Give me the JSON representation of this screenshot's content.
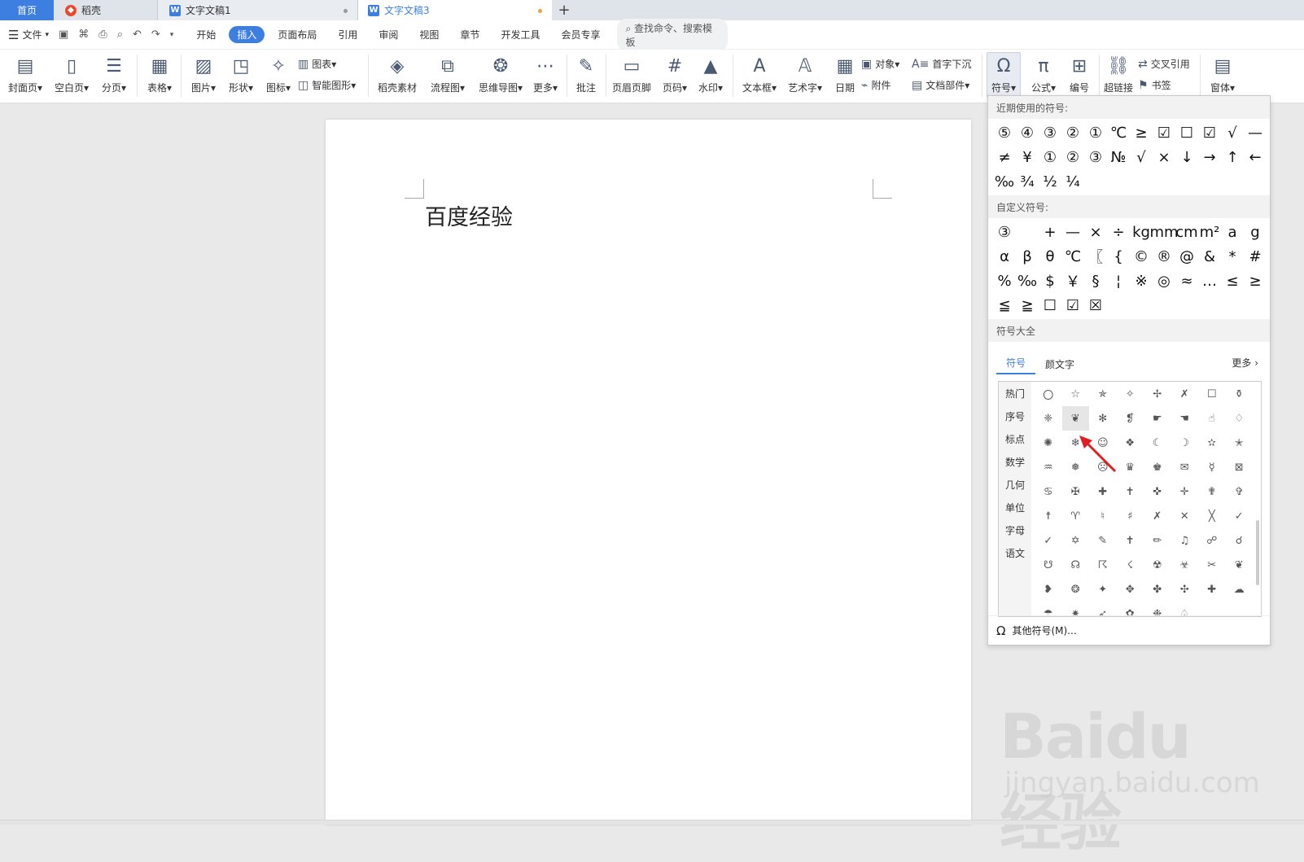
{
  "tabs": {
    "home": "首页",
    "docer": "稻壳",
    "doc1": "文字文稿1",
    "doc3": "文字文稿3",
    "new_tab": "+"
  },
  "menu": {
    "file": "文件",
    "items": [
      "开始",
      "插入",
      "页面布局",
      "引用",
      "审阅",
      "视图",
      "章节",
      "开发工具",
      "会员专享"
    ],
    "active": "插入",
    "search_placeholder": "查找命令、搜索模板"
  },
  "ribbon": {
    "cover": "封面页",
    "blank": "空白页",
    "pagebreak": "分页",
    "table": "表格",
    "picture": "图片",
    "shape": "形状",
    "icon": "图标",
    "chart": "图表",
    "smartart": "智能图形",
    "docer_material": "稻壳素材",
    "flowchart": "流程图",
    "mindmap": "思维导图",
    "more": "更多",
    "comment": "批注",
    "header_footer": "页眉页脚",
    "page_number": "页码",
    "watermark": "水印",
    "textbox": "文本框",
    "wordart": "艺术字",
    "date": "日期",
    "object": "对象",
    "attachment": "附件",
    "dropcap": "首字下沉",
    "docparts": "文档部件",
    "symbol": "符号",
    "formula": "公式",
    "numbering": "编号",
    "hyperlink": "超链接",
    "crossref": "交叉引用",
    "bookmark": "书签",
    "form": "窗体"
  },
  "document": {
    "text": "百度经验"
  },
  "symbol_panel": {
    "recent_header": "近期使用的符号:",
    "recent": [
      "⑤",
      "④",
      "③",
      "②",
      "①",
      "℃",
      "≥",
      "☑",
      "☐",
      "☑",
      "√",
      "—",
      "≠",
      "¥",
      "①",
      "②",
      "③",
      "№",
      "√",
      "×",
      "↓",
      "→",
      "↑",
      "←",
      "‰",
      "¾",
      "½",
      "¼"
    ],
    "custom_header": "自定义符号:",
    "custom": [
      "③",
      "",
      "+",
      "—",
      "×",
      "÷",
      "kg",
      "mm",
      "cm",
      "m²",
      "a",
      "g",
      "α",
      "β",
      "θ",
      "℃",
      "〖",
      "{",
      "©",
      "®",
      "@",
      "&",
      "*",
      "#",
      "%",
      "‰",
      "$",
      "￥",
      "§",
      "¦",
      "※",
      "◎",
      "≈",
      "…",
      "≤",
      "≥",
      "≦",
      "≧",
      "☐",
      "☑",
      "☒"
    ],
    "all_header": "符号大全",
    "tab_symbol": "符号",
    "tab_kaomoji": "颜文字",
    "more": "更多",
    "categories": [
      "热门",
      "序号",
      "标点",
      "数学",
      "几何",
      "单位",
      "字母",
      "语文"
    ],
    "grid": [
      "〇",
      "☆",
      "✯",
      "✧",
      "✢",
      "✗",
      "☐",
      "⚱",
      "❈",
      "❦",
      "✻",
      "❡",
      "☛",
      "☚",
      "☝",
      "♢",
      "✺",
      "❄",
      "☺",
      "❖",
      "☾",
      "☽",
      "✫",
      "✭",
      "♒",
      "❅",
      "☹",
      "♛",
      "♚",
      "✉",
      "☿",
      "⊠",
      "♋",
      "✠",
      "✚",
      "✝",
      "✜",
      "✛",
      "✟",
      "✞",
      "☨",
      "♈",
      "♮",
      "♯",
      "✗",
      "✕",
      "╳",
      "✓",
      "✓",
      "✡",
      "✎",
      "✝",
      "✏",
      "♫",
      "☍",
      "☌",
      "☋",
      "☊",
      "☈",
      "☇",
      "☢",
      "☣",
      "✂",
      "❦",
      "❥",
      "❂",
      "✦",
      "✥",
      "✤",
      "✣",
      "✚",
      "☁",
      "☂",
      "✷",
      "➶",
      "✿",
      "❉",
      "♤"
    ],
    "highlighted_index": 9,
    "other_symbols": "其他符号(M)..."
  },
  "watermark": {
    "brand": "Baidu经验",
    "url": "jingyan.baidu.com"
  }
}
